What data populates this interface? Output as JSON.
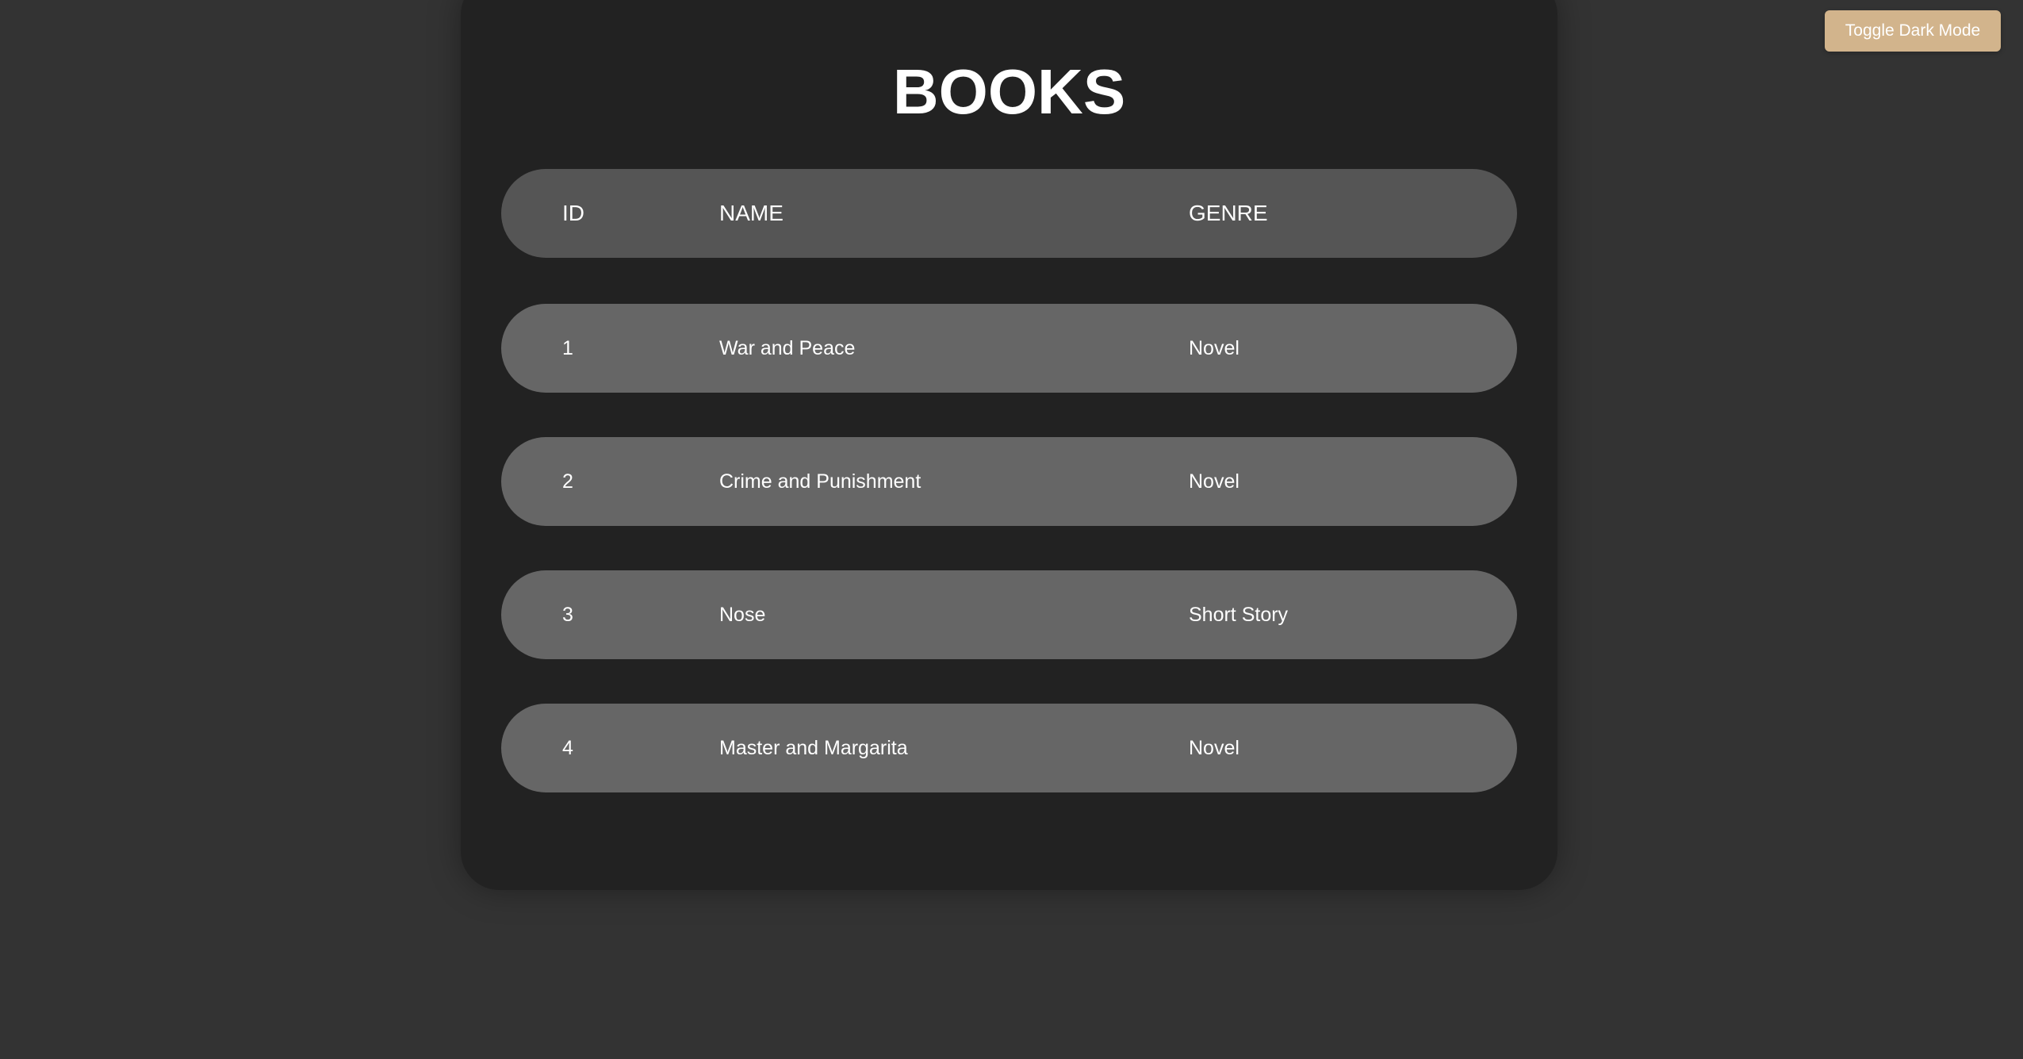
{
  "toolbar": {
    "toggle_label": "Toggle Dark Mode"
  },
  "page": {
    "title": "BOOKS"
  },
  "table": {
    "headers": {
      "id": "ID",
      "name": "NAME",
      "genre": "GENRE"
    },
    "rows": [
      {
        "id": "1",
        "name": "War and Peace",
        "genre": "Novel"
      },
      {
        "id": "2",
        "name": "Crime and Punishment",
        "genre": "Novel"
      },
      {
        "id": "3",
        "name": "Nose",
        "genre": "Short Story"
      },
      {
        "id": "4",
        "name": "Master and Margarita",
        "genre": "Novel"
      }
    ]
  },
  "colors": {
    "page_background": "#333333",
    "card_background": "#222222",
    "header_row": "#555555",
    "body_row": "#666666",
    "toggle_button": "#d2b48c",
    "text": "#ffffff"
  }
}
